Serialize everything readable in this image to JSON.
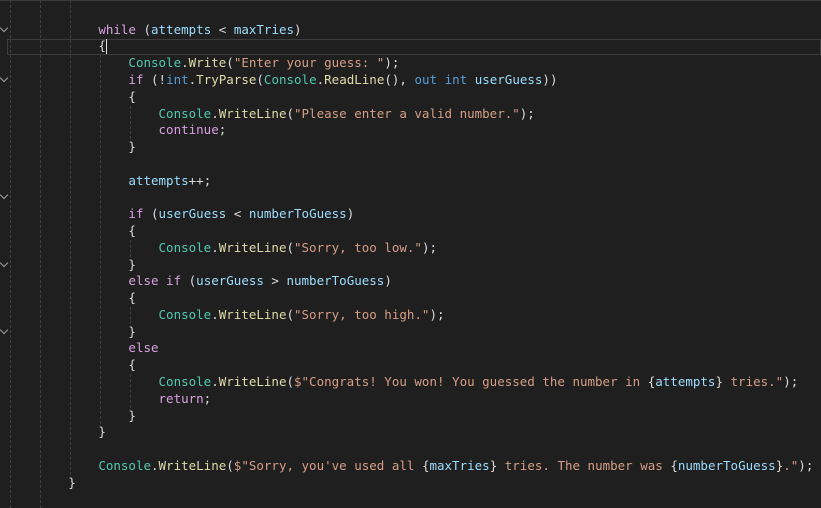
{
  "editor": {
    "colors": {
      "kw": "#d8a0df",
      "kb": "#569cd6",
      "cls": "#4ec9b0",
      "fn": "#dcdcaa",
      "str": "#d69d85",
      "var": "#9cdcfe",
      "p": "#dcdcdc"
    },
    "current_line": 1,
    "folded_lines": [
      0,
      3,
      10,
      14,
      18
    ],
    "lines": [
      {
        "indent": 12,
        "tokens": [
          [
            "kw",
            "while"
          ],
          [
            "p",
            " ("
          ],
          [
            "var",
            "attempts"
          ],
          [
            "p",
            " < "
          ],
          [
            "var",
            "maxTries"
          ],
          [
            "p",
            ")"
          ]
        ]
      },
      {
        "indent": 12,
        "tokens": [
          [
            "p",
            "{"
          ]
        ]
      },
      {
        "indent": 16,
        "tokens": [
          [
            "cls",
            "Console"
          ],
          [
            "p",
            "."
          ],
          [
            "fn",
            "Write"
          ],
          [
            "p",
            "("
          ],
          [
            "str",
            "\"Enter your guess: \""
          ],
          [
            "p",
            ");"
          ]
        ]
      },
      {
        "indent": 16,
        "tokens": [
          [
            "kw",
            "if"
          ],
          [
            "p",
            " (!"
          ],
          [
            "kb",
            "int"
          ],
          [
            "p",
            "."
          ],
          [
            "fn",
            "TryParse"
          ],
          [
            "p",
            "("
          ],
          [
            "cls",
            "Console"
          ],
          [
            "p",
            "."
          ],
          [
            "fn",
            "ReadLine"
          ],
          [
            "p",
            "(), "
          ],
          [
            "kb",
            "out"
          ],
          [
            "p",
            " "
          ],
          [
            "kb",
            "int"
          ],
          [
            "p",
            " "
          ],
          [
            "var",
            "userGuess"
          ],
          [
            "p",
            "))"
          ]
        ]
      },
      {
        "indent": 16,
        "tokens": [
          [
            "p",
            "{"
          ]
        ]
      },
      {
        "indent": 20,
        "tokens": [
          [
            "cls",
            "Console"
          ],
          [
            "p",
            "."
          ],
          [
            "fn",
            "WriteLine"
          ],
          [
            "p",
            "("
          ],
          [
            "str",
            "\"Please enter a valid number.\""
          ],
          [
            "p",
            ");"
          ]
        ]
      },
      {
        "indent": 20,
        "tokens": [
          [
            "kw",
            "continue"
          ],
          [
            "p",
            ";"
          ]
        ]
      },
      {
        "indent": 16,
        "tokens": [
          [
            "p",
            "}"
          ]
        ]
      },
      {
        "indent": 0,
        "tokens": []
      },
      {
        "indent": 16,
        "tokens": [
          [
            "var",
            "attempts"
          ],
          [
            "p",
            "++;"
          ]
        ]
      },
      {
        "indent": 0,
        "tokens": []
      },
      {
        "indent": 16,
        "tokens": [
          [
            "kw",
            "if"
          ],
          [
            "p",
            " ("
          ],
          [
            "var",
            "userGuess"
          ],
          [
            "p",
            " < "
          ],
          [
            "var",
            "numberToGuess"
          ],
          [
            "p",
            ")"
          ]
        ]
      },
      {
        "indent": 16,
        "tokens": [
          [
            "p",
            "{"
          ]
        ]
      },
      {
        "indent": 20,
        "tokens": [
          [
            "cls",
            "Console"
          ],
          [
            "p",
            "."
          ],
          [
            "fn",
            "WriteLine"
          ],
          [
            "p",
            "("
          ],
          [
            "str",
            "\"Sorry, too low.\""
          ],
          [
            "p",
            ");"
          ]
        ]
      },
      {
        "indent": 16,
        "tokens": [
          [
            "p",
            "}"
          ]
        ]
      },
      {
        "indent": 16,
        "tokens": [
          [
            "kw",
            "else if"
          ],
          [
            "p",
            " ("
          ],
          [
            "var",
            "userGuess"
          ],
          [
            "p",
            " > "
          ],
          [
            "var",
            "numberToGuess"
          ],
          [
            "p",
            ")"
          ]
        ]
      },
      {
        "indent": 16,
        "tokens": [
          [
            "p",
            "{"
          ]
        ]
      },
      {
        "indent": 20,
        "tokens": [
          [
            "cls",
            "Console"
          ],
          [
            "p",
            "."
          ],
          [
            "fn",
            "WriteLine"
          ],
          [
            "p",
            "("
          ],
          [
            "str",
            "\"Sorry, too high.\""
          ],
          [
            "p",
            ");"
          ]
        ]
      },
      {
        "indent": 16,
        "tokens": [
          [
            "p",
            "}"
          ]
        ]
      },
      {
        "indent": 16,
        "tokens": [
          [
            "kw",
            "else"
          ]
        ]
      },
      {
        "indent": 16,
        "tokens": [
          [
            "p",
            "{"
          ]
        ]
      },
      {
        "indent": 20,
        "tokens": [
          [
            "cls",
            "Console"
          ],
          [
            "p",
            "."
          ],
          [
            "fn",
            "WriteLine"
          ],
          [
            "p",
            "("
          ],
          [
            "str",
            "$\"Congrats! You won! You guessed the number in "
          ],
          [
            "p",
            "{"
          ],
          [
            "var",
            "attempts"
          ],
          [
            "p",
            "}"
          ],
          [
            "str",
            " tries.\""
          ],
          [
            "p",
            ");"
          ]
        ]
      },
      {
        "indent": 20,
        "tokens": [
          [
            "kw",
            "return"
          ],
          [
            "p",
            ";"
          ]
        ]
      },
      {
        "indent": 16,
        "tokens": [
          [
            "p",
            "}"
          ]
        ]
      },
      {
        "indent": 12,
        "tokens": [
          [
            "p",
            "}"
          ]
        ]
      },
      {
        "indent": 0,
        "tokens": []
      },
      {
        "indent": 12,
        "tokens": [
          [
            "cls",
            "Console"
          ],
          [
            "p",
            "."
          ],
          [
            "fn",
            "WriteLine"
          ],
          [
            "p",
            "("
          ],
          [
            "str",
            "$\"Sorry, you've used all "
          ],
          [
            "p",
            "{"
          ],
          [
            "var",
            "maxTries"
          ],
          [
            "p",
            "}"
          ],
          [
            "str",
            " tries. The number was "
          ],
          [
            "p",
            "{"
          ],
          [
            "var",
            "numberToGuess"
          ],
          [
            "p",
            "}"
          ],
          [
            "str",
            ".\""
          ],
          [
            "p",
            ");"
          ]
        ]
      },
      {
        "indent": 8,
        "tokens": [
          [
            "p",
            "}"
          ]
        ]
      }
    ]
  }
}
